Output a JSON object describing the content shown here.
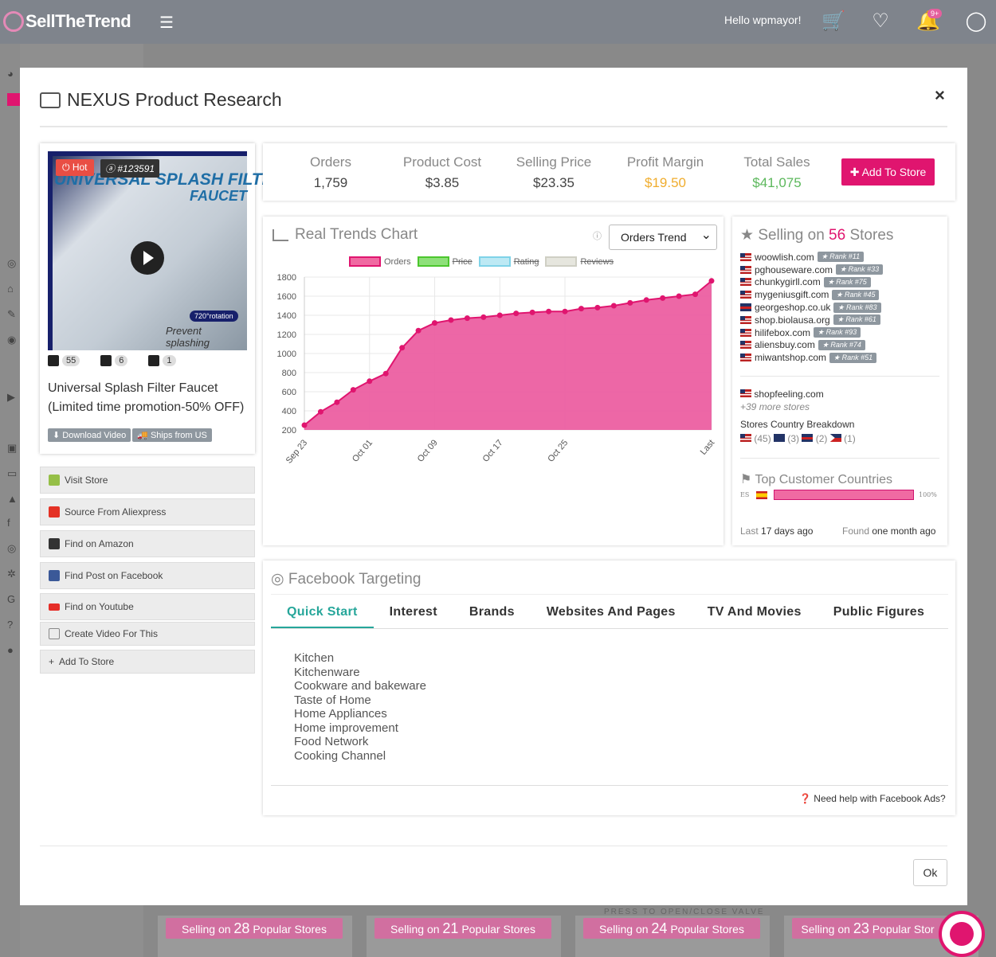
{
  "topbar": {
    "logo_text": "SellTheTrend",
    "greeting": "Hello wpmayor!",
    "notif_count": "9+"
  },
  "modal": {
    "title": "NEXUS Product Research",
    "close": "×",
    "ok": "Ok"
  },
  "product": {
    "hot": "Hot",
    "id": "#123591",
    "image_title_1": "UNIVERSAL SPLASH FILTER",
    "image_title_2": "FAUCET",
    "image_rotation": "720°rotation",
    "image_tagline": "Prevent splashing",
    "stat_shopify": "55",
    "stat_ali": "6",
    "stat_amazon": "1",
    "name": "Universal Splash Filter Faucet (Limited time promotion-50% OFF)",
    "download_video": "Download Video",
    "ships_from": "Ships from US"
  },
  "actions": [
    {
      "label": "Visit Store",
      "icon": "shopify-icon",
      "color": "#95bf47"
    },
    {
      "label": "Source From Aliexpress",
      "icon": "aliexpress-icon",
      "color": "#e43225"
    },
    {
      "label": "Find on Amazon",
      "icon": "amazon-icon",
      "color": "#333333"
    },
    {
      "label": "Find Post on Facebook",
      "icon": "facebook-icon",
      "color": "#3b5998"
    },
    {
      "label": "Find on Youtube",
      "icon": "youtube-icon",
      "color": "#e52d27"
    },
    {
      "label": "Create Video For This",
      "icon": "film-icon",
      "color": "#888888"
    },
    {
      "label": "Add To Store",
      "icon": "plus-icon",
      "color": "#888888"
    }
  ],
  "stats": {
    "orders_label": "Orders",
    "orders": "1,759",
    "cost_label": "Product Cost",
    "cost": "$3.85",
    "price_label": "Selling Price",
    "price": "$23.35",
    "margin_label": "Profit Margin",
    "margin": "$19.50",
    "total_label": "Total Sales",
    "total": "$41,075",
    "add_to_store": "Add To Store"
  },
  "trend": {
    "title": "Real Trends Chart",
    "select_value": "Orders Trend",
    "legend": [
      "Orders",
      "Price",
      "Rating",
      "Reviews"
    ]
  },
  "chart_data": {
    "type": "area",
    "series": [
      {
        "name": "Orders",
        "values": [
          250,
          390,
          490,
          620,
          710,
          790,
          1060,
          1240,
          1320,
          1350,
          1370,
          1380,
          1400,
          1420,
          1430,
          1440,
          1440,
          1470,
          1480,
          1500,
          1530,
          1560,
          1580,
          1600,
          1620,
          1760
        ]
      }
    ],
    "x_tick_labels": [
      "Sep 23",
      "Oct 01",
      "Oct 09",
      "Oct 17",
      "Oct 25",
      "Last"
    ],
    "ylim": [
      200,
      1800
    ],
    "yticks": [
      200,
      400,
      600,
      800,
      1000,
      1200,
      1400,
      1600,
      1800
    ],
    "colors": {
      "Orders": "#e0156f",
      "Price": "#4cc62e",
      "Rating": "#7fd3e8",
      "Reviews": "#cfcfc4"
    }
  },
  "stores": {
    "title_prefix": "Selling on",
    "count": "56",
    "title_suffix": "Stores",
    "list": [
      {
        "domain": "woowlish.com",
        "rank": "Rank #11",
        "flag": "us"
      },
      {
        "domain": "pghouseware.com",
        "rank": "Rank #33",
        "flag": "us"
      },
      {
        "domain": "chunkygirll.com",
        "rank": "Rank #75",
        "flag": "us"
      },
      {
        "domain": "mygeniusgift.com",
        "rank": "Rank #45",
        "flag": "us"
      },
      {
        "domain": "georgeshop.co.uk",
        "rank": "Rank #83",
        "flag": "uk"
      },
      {
        "domain": "shop.biolausa.org",
        "rank": "Rank #61",
        "flag": "us"
      },
      {
        "domain": "hilifebox.com",
        "rank": "Rank #93",
        "flag": "us"
      },
      {
        "domain": "aliensbuy.com",
        "rank": "Rank #74",
        "flag": "us"
      },
      {
        "domain": "miwantshop.com",
        "rank": "Rank #51",
        "flag": "us"
      }
    ],
    "extra_store": "shopfeeling.com",
    "more": "+39 more stores",
    "breakdown_label": "Stores Country Breakdown",
    "breakdown": [
      "(45)",
      "(3)",
      "(2)",
      "(1)"
    ],
    "top_countries_label": "Top Customer Countries",
    "country_code": "ES",
    "country_pct": "100%",
    "last_label": "Last",
    "last_value": "17 days ago",
    "found_label": "Found",
    "found_value": "one month ago"
  },
  "facebook": {
    "title": "Facebook Targeting",
    "tabs": [
      "Quick Start",
      "Interest",
      "Brands",
      "Websites And Pages",
      "TV And Movies",
      "Public Figures"
    ],
    "interests": [
      "Kitchen",
      "Kitchenware",
      "Cookware and bakeware",
      "Taste of Home",
      "Home Appliances",
      "Home improvement",
      "Food Network",
      "Cooking Channel"
    ],
    "help": "Need help with Facebook Ads?"
  },
  "background_cards": [
    {
      "prefix": "Selling on",
      "count": "28",
      "suffix": "Popular Stores"
    },
    {
      "prefix": "Selling on",
      "count": "21",
      "suffix": "Popular Stores"
    },
    {
      "prefix": "Selling on",
      "count": "24",
      "suffix": "Popular Stores"
    },
    {
      "prefix": "Selling on",
      "count": "23",
      "suffix": "Popular Stor"
    }
  ],
  "bg_caption": "PRESS TO OPEN/CLOSE VALVE"
}
